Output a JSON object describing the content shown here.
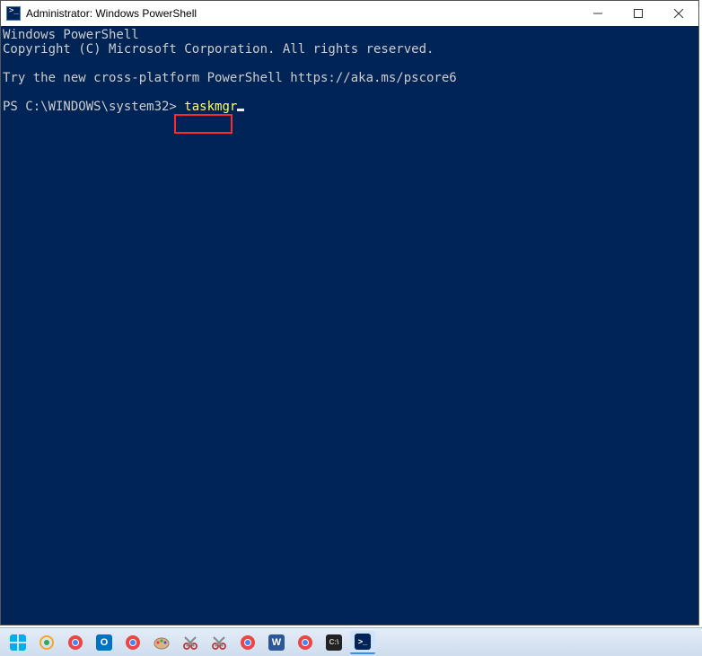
{
  "window": {
    "title": "Administrator: Windows PowerShell"
  },
  "terminal": {
    "line1": "Windows PowerShell",
    "line2": "Copyright (C) Microsoft Corporation. All rights reserved.",
    "line3": "Try the new cross-platform PowerShell https://aka.ms/pscore6",
    "prompt": "PS C:\\WINDOWS\\system32> ",
    "command": "taskmgr"
  },
  "taskbar": {
    "items": [
      {
        "name": "start",
        "color": "#00adef"
      },
      {
        "name": "meet",
        "color": "#f5a623"
      },
      {
        "name": "chrome-1",
        "color": "#e44"
      },
      {
        "name": "outlook",
        "color": "#0072c6"
      },
      {
        "name": "chrome-2",
        "color": "#e44"
      },
      {
        "name": "paint",
        "color": "#d9b38c"
      },
      {
        "name": "snip",
        "color": "#b44"
      },
      {
        "name": "snip2",
        "color": "#b44"
      },
      {
        "name": "chrome-3",
        "color": "#e44"
      },
      {
        "name": "word",
        "color": "#2b579a"
      },
      {
        "name": "chrome-4",
        "color": "#e44"
      },
      {
        "name": "cmd",
        "color": "#222"
      },
      {
        "name": "powershell",
        "color": "#012456",
        "active": true
      }
    ]
  }
}
